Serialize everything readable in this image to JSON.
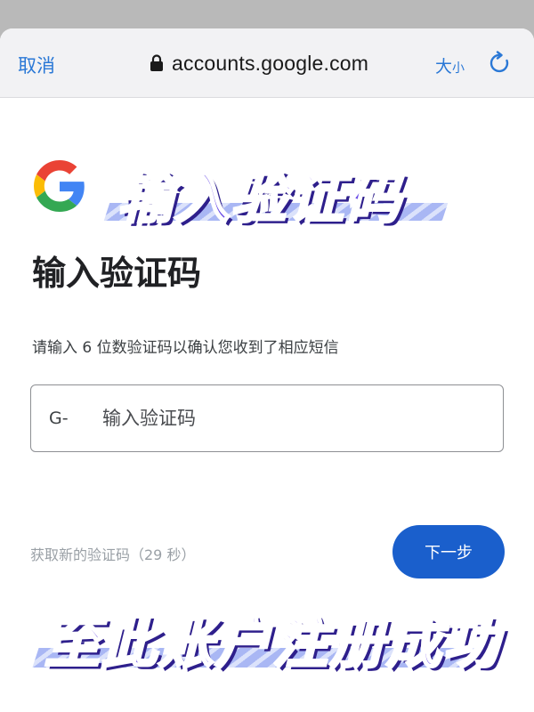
{
  "browser": {
    "cancel_label": "取消",
    "url": "accounts.google.com",
    "text_size_big": "大",
    "text_size_small": "小",
    "icons": {
      "lock": "lock-icon",
      "reload": "reload-icon"
    },
    "accent_color": "#2a78d6"
  },
  "brand": {
    "logo": "google-g-logo"
  },
  "overlay": {
    "top_caption": "输入验证码",
    "bottom_caption": "至此账户注册成功",
    "color": "#6b4de6"
  },
  "form": {
    "title": "输入验证码",
    "description": "请输入 6 位数验证码以确认您收到了相应短信",
    "code_prefix": "G-",
    "code_placeholder": "输入验证码",
    "code_value": "",
    "resend_label": "获取新的验证码（29 秒）",
    "next_label": "下一步",
    "button_color": "#1a5fcc"
  }
}
